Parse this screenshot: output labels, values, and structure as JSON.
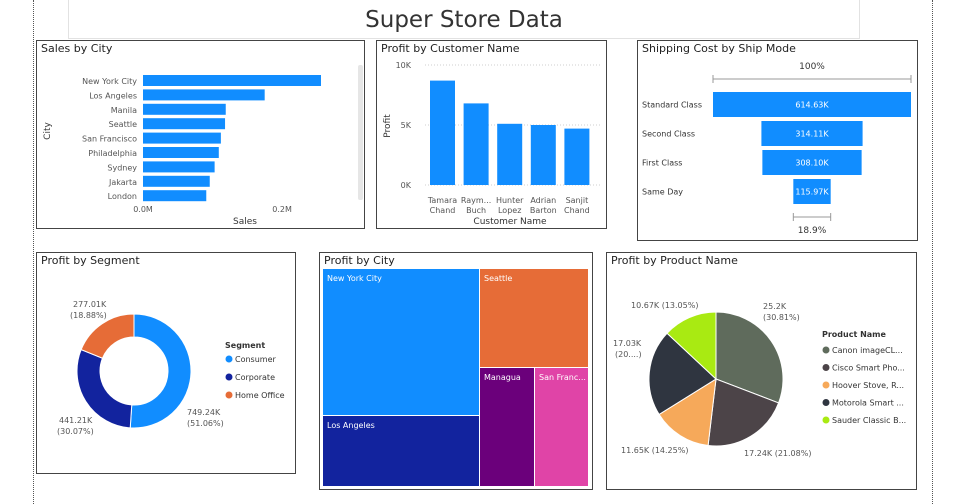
{
  "page": {
    "title": "Super Store Data"
  },
  "chart_data": [
    {
      "id": "sales_city",
      "type": "bar",
      "orientation": "horizontal",
      "title": "Sales by City",
      "xlabel": "Sales",
      "ylabel": "City",
      "categories": [
        "New York City",
        "Los Angeles",
        "Manila",
        "Seattle",
        "San Francisco",
        "Philadelphia",
        "Sydney",
        "Jakarta",
        "London"
      ],
      "values": [
        0.256,
        0.175,
        0.119,
        0.118,
        0.112,
        0.109,
        0.103,
        0.096,
        0.091
      ],
      "xticks": [
        "0.0M",
        "0.2M"
      ],
      "xlim": [
        0,
        0.3
      ],
      "color": "#118DFF"
    },
    {
      "id": "profit_customer",
      "type": "bar",
      "title": "Profit by Customer Name",
      "xlabel": "Customer Name",
      "ylabel": "Profit",
      "categories": [
        "Tamara Chand",
        "Raym... Buch",
        "Hunter Lopez",
        "Adrian Barton",
        "Sanjit Chand"
      ],
      "category_lines": [
        [
          "Tamara",
          "Chand"
        ],
        [
          "Raym...",
          "Buch"
        ],
        [
          "Hunter",
          "Lopez"
        ],
        [
          "Adrian",
          "Barton"
        ],
        [
          "Sanjit",
          "Chand"
        ]
      ],
      "values": [
        8.7,
        6.8,
        5.1,
        5.0,
        4.7
      ],
      "yticks": [
        "0K",
        "5K",
        "10K"
      ],
      "ylim": [
        0,
        10
      ],
      "color": "#118DFF"
    },
    {
      "id": "shipping_funnel",
      "type": "funnel",
      "title": "Shipping Cost by Ship Mode",
      "categories": [
        "Standard Class",
        "Second Class",
        "First Class",
        "Same Day"
      ],
      "values": [
        614.63,
        314.11,
        308.1,
        115.97
      ],
      "value_labels": [
        "614.63K",
        "314.11K",
        "308.10K",
        "115.97K"
      ],
      "top_label": "100%",
      "bottom_label": "18.9%",
      "color": "#118DFF"
    },
    {
      "id": "profit_segment",
      "type": "pie",
      "donut": true,
      "title": "Profit by Segment",
      "legend_title": "Segment",
      "legend_position": "right",
      "series": [
        {
          "name": "Consumer",
          "value": 749.24,
          "label1": "749.24K",
          "label2": "(51.06%)",
          "color": "#118DFF"
        },
        {
          "name": "Corporate",
          "value": 441.21,
          "label1": "441.21K",
          "label2": "(30.07%)",
          "color": "#12239E"
        },
        {
          "name": "Home Office",
          "value": 277.01,
          "label1": "277.01K",
          "label2": "(18.88%)",
          "color": "#E66C37"
        }
      ]
    },
    {
      "id": "profit_city",
      "type": "treemap",
      "title": "Profit by City",
      "cells": [
        {
          "name": "New York City",
          "color": "#118DFF"
        },
        {
          "name": "Los Angeles",
          "color": "#12239E"
        },
        {
          "name": "Seattle",
          "color": "#E66C37"
        },
        {
          "name": "Managua",
          "color": "#6B007B"
        },
        {
          "name": "San Franc...",
          "color": "#E044A7"
        }
      ]
    },
    {
      "id": "profit_product",
      "type": "pie",
      "title": "Profit by Product Name",
      "legend_title": "Product Name",
      "legend_position": "right",
      "series": [
        {
          "name": "Canon imageCL...",
          "value": 25.2,
          "label1": "25.2K",
          "label2": "(30.81%)",
          "color": "#5F6B5C"
        },
        {
          "name": "Cisco Smart Pho...",
          "value": 17.24,
          "label1": "17.24K (21.08%)",
          "label2": "",
          "color": "#4C4448"
        },
        {
          "name": "Hoover Stove, R...",
          "value": 11.65,
          "label1": "11.65K (14.25%)",
          "label2": "",
          "color": "#F6A95A"
        },
        {
          "name": "Motorola Smart ...",
          "value": 17.03,
          "label1": "17.03K",
          "label2": "(20....)",
          "color": "#2F3540"
        },
        {
          "name": "Sauder Classic B...",
          "value": 10.67,
          "label1": "10.67K (13.05%)",
          "label2": "",
          "color": "#A9EA12"
        }
      ]
    }
  ]
}
